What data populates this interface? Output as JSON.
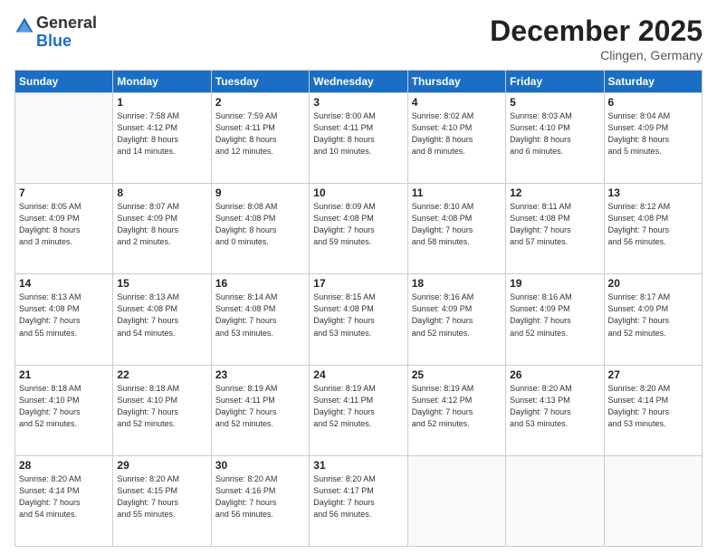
{
  "logo": {
    "general": "General",
    "blue": "Blue"
  },
  "title": "December 2025",
  "location": "Clingen, Germany",
  "days_of_week": [
    "Sunday",
    "Monday",
    "Tuesday",
    "Wednesday",
    "Thursday",
    "Friday",
    "Saturday"
  ],
  "weeks": [
    [
      {
        "day": "",
        "info": ""
      },
      {
        "day": "1",
        "info": "Sunrise: 7:58 AM\nSunset: 4:12 PM\nDaylight: 8 hours\nand 14 minutes."
      },
      {
        "day": "2",
        "info": "Sunrise: 7:59 AM\nSunset: 4:11 PM\nDaylight: 8 hours\nand 12 minutes."
      },
      {
        "day": "3",
        "info": "Sunrise: 8:00 AM\nSunset: 4:11 PM\nDaylight: 8 hours\nand 10 minutes."
      },
      {
        "day": "4",
        "info": "Sunrise: 8:02 AM\nSunset: 4:10 PM\nDaylight: 8 hours\nand 8 minutes."
      },
      {
        "day": "5",
        "info": "Sunrise: 8:03 AM\nSunset: 4:10 PM\nDaylight: 8 hours\nand 6 minutes."
      },
      {
        "day": "6",
        "info": "Sunrise: 8:04 AM\nSunset: 4:09 PM\nDaylight: 8 hours\nand 5 minutes."
      }
    ],
    [
      {
        "day": "7",
        "info": "Sunrise: 8:05 AM\nSunset: 4:09 PM\nDaylight: 8 hours\nand 3 minutes."
      },
      {
        "day": "8",
        "info": "Sunrise: 8:07 AM\nSunset: 4:09 PM\nDaylight: 8 hours\nand 2 minutes."
      },
      {
        "day": "9",
        "info": "Sunrise: 8:08 AM\nSunset: 4:08 PM\nDaylight: 8 hours\nand 0 minutes."
      },
      {
        "day": "10",
        "info": "Sunrise: 8:09 AM\nSunset: 4:08 PM\nDaylight: 7 hours\nand 59 minutes."
      },
      {
        "day": "11",
        "info": "Sunrise: 8:10 AM\nSunset: 4:08 PM\nDaylight: 7 hours\nand 58 minutes."
      },
      {
        "day": "12",
        "info": "Sunrise: 8:11 AM\nSunset: 4:08 PM\nDaylight: 7 hours\nand 57 minutes."
      },
      {
        "day": "13",
        "info": "Sunrise: 8:12 AM\nSunset: 4:08 PM\nDaylight: 7 hours\nand 56 minutes."
      }
    ],
    [
      {
        "day": "14",
        "info": "Sunrise: 8:13 AM\nSunset: 4:08 PM\nDaylight: 7 hours\nand 55 minutes."
      },
      {
        "day": "15",
        "info": "Sunrise: 8:13 AM\nSunset: 4:08 PM\nDaylight: 7 hours\nand 54 minutes."
      },
      {
        "day": "16",
        "info": "Sunrise: 8:14 AM\nSunset: 4:08 PM\nDaylight: 7 hours\nand 53 minutes."
      },
      {
        "day": "17",
        "info": "Sunrise: 8:15 AM\nSunset: 4:08 PM\nDaylight: 7 hours\nand 53 minutes."
      },
      {
        "day": "18",
        "info": "Sunrise: 8:16 AM\nSunset: 4:09 PM\nDaylight: 7 hours\nand 52 minutes."
      },
      {
        "day": "19",
        "info": "Sunrise: 8:16 AM\nSunset: 4:09 PM\nDaylight: 7 hours\nand 52 minutes."
      },
      {
        "day": "20",
        "info": "Sunrise: 8:17 AM\nSunset: 4:09 PM\nDaylight: 7 hours\nand 52 minutes."
      }
    ],
    [
      {
        "day": "21",
        "info": "Sunrise: 8:18 AM\nSunset: 4:10 PM\nDaylight: 7 hours\nand 52 minutes."
      },
      {
        "day": "22",
        "info": "Sunrise: 8:18 AM\nSunset: 4:10 PM\nDaylight: 7 hours\nand 52 minutes."
      },
      {
        "day": "23",
        "info": "Sunrise: 8:19 AM\nSunset: 4:11 PM\nDaylight: 7 hours\nand 52 minutes."
      },
      {
        "day": "24",
        "info": "Sunrise: 8:19 AM\nSunset: 4:11 PM\nDaylight: 7 hours\nand 52 minutes."
      },
      {
        "day": "25",
        "info": "Sunrise: 8:19 AM\nSunset: 4:12 PM\nDaylight: 7 hours\nand 52 minutes."
      },
      {
        "day": "26",
        "info": "Sunrise: 8:20 AM\nSunset: 4:13 PM\nDaylight: 7 hours\nand 53 minutes."
      },
      {
        "day": "27",
        "info": "Sunrise: 8:20 AM\nSunset: 4:14 PM\nDaylight: 7 hours\nand 53 minutes."
      }
    ],
    [
      {
        "day": "28",
        "info": "Sunrise: 8:20 AM\nSunset: 4:14 PM\nDaylight: 7 hours\nand 54 minutes."
      },
      {
        "day": "29",
        "info": "Sunrise: 8:20 AM\nSunset: 4:15 PM\nDaylight: 7 hours\nand 55 minutes."
      },
      {
        "day": "30",
        "info": "Sunrise: 8:20 AM\nSunset: 4:16 PM\nDaylight: 7 hours\nand 56 minutes."
      },
      {
        "day": "31",
        "info": "Sunrise: 8:20 AM\nSunset: 4:17 PM\nDaylight: 7 hours\nand 56 minutes."
      },
      {
        "day": "",
        "info": ""
      },
      {
        "day": "",
        "info": ""
      },
      {
        "day": "",
        "info": ""
      }
    ]
  ]
}
